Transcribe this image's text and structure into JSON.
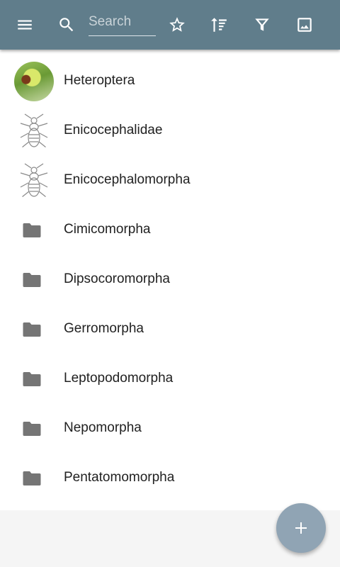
{
  "toolbar": {
    "menu_icon": "menu-icon",
    "search_icon": "search-icon",
    "search_placeholder": "Search",
    "favorite_icon": "star-outline-icon",
    "sort_icon": "sort-icon",
    "filter_icon": "filter-icon",
    "image_icon": "image-icon",
    "color": "#607d8b"
  },
  "list": {
    "items": [
      {
        "label": "Heteroptera",
        "thumbnail": "photo"
      },
      {
        "label": "Enicocephalidae",
        "thumbnail": "drawing"
      },
      {
        "label": "Enicocephalomorpha",
        "thumbnail": "drawing"
      },
      {
        "label": "Cimicomorpha",
        "thumbnail": "folder-icon"
      },
      {
        "label": "Dipsocoromorpha",
        "thumbnail": "folder-icon"
      },
      {
        "label": "Gerromorpha",
        "thumbnail": "folder-icon"
      },
      {
        "label": "Leptopodomorpha",
        "thumbnail": "folder-icon"
      },
      {
        "label": "Nepomorpha",
        "thumbnail": "folder-icon"
      },
      {
        "label": "Pentatomomorpha",
        "thumbnail": "folder-icon"
      }
    ]
  },
  "fab": {
    "icon": "plus-icon",
    "color": "#90a4b4"
  }
}
